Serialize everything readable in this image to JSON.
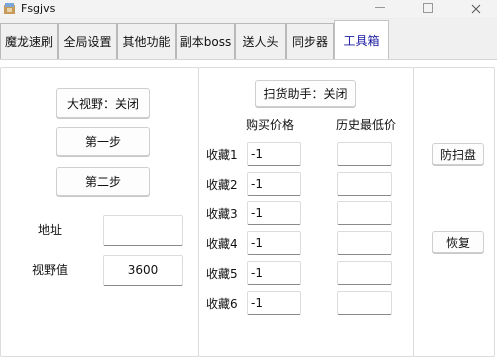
{
  "window": {
    "title": "Fsgjvs"
  },
  "tabs": [
    {
      "label": "魔龙速刷"
    },
    {
      "label": "全局设置"
    },
    {
      "label": "其他功能"
    },
    {
      "label": "副本boss"
    },
    {
      "label": "送人头"
    },
    {
      "label": "同步器"
    },
    {
      "label": "工具箱",
      "active": true
    }
  ],
  "left_panel": {
    "wide_view_button": "大视野：关闭",
    "step1_button": "第一步",
    "step2_button": "第二步",
    "address_label": "地址",
    "address_value": "",
    "fov_label": "视野值",
    "fov_value": "3600"
  },
  "middle_panel": {
    "sweep_button": "扫货助手：关闭",
    "col_buy_price": "购买价格",
    "col_lowest_price": "历史最低价",
    "rows": [
      {
        "label": "收藏1",
        "buy_price": "-1",
        "lowest_price": ""
      },
      {
        "label": "收藏2",
        "buy_price": "-1",
        "lowest_price": ""
      },
      {
        "label": "收藏3",
        "buy_price": "-1",
        "lowest_price": ""
      },
      {
        "label": "收藏4",
        "buy_price": "-1",
        "lowest_price": ""
      },
      {
        "label": "收藏5",
        "buy_price": "-1",
        "lowest_price": ""
      },
      {
        "label": "收藏6",
        "buy_price": "-1",
        "lowest_price": ""
      }
    ]
  },
  "right_panel": {
    "anti_sweep_button": "防扫盘",
    "restore_button": "恢复"
  }
}
